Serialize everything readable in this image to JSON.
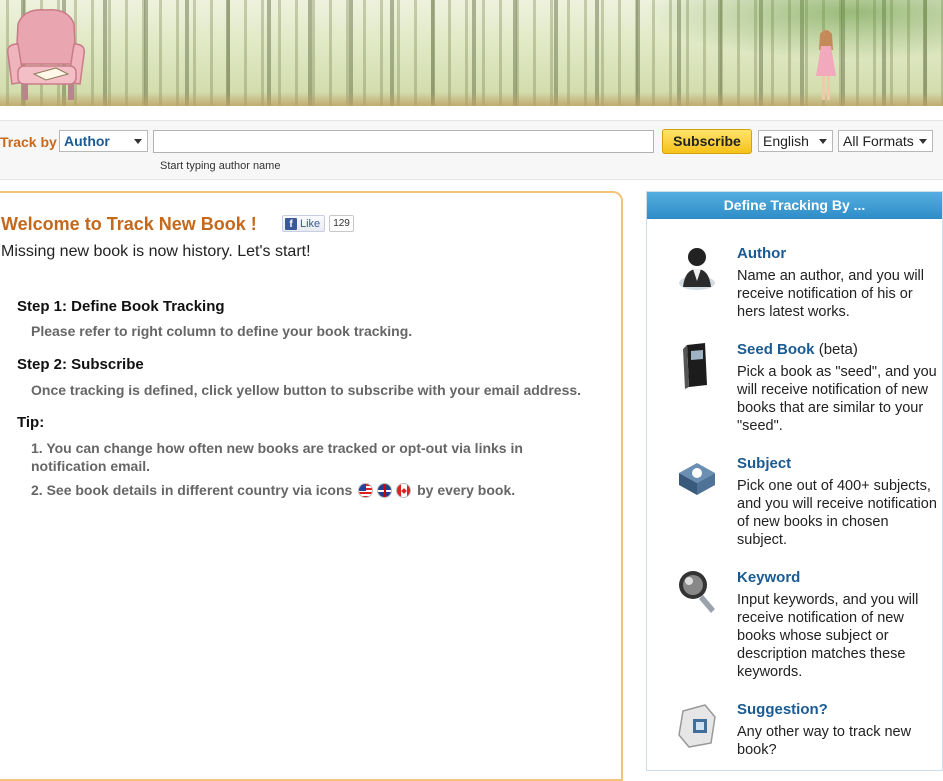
{
  "track_bar": {
    "label": "Track by",
    "track_type": "Author",
    "search_value": "",
    "search_hint": "Start typing author name",
    "subscribe_label": "Subscribe",
    "language": "English",
    "format": "All Formats"
  },
  "main": {
    "welcome_title": "Welcome to Track New Book !",
    "fb_like_label": "Like",
    "fb_like_count": "129",
    "tagline": "Missing new book is now history. Let's start!",
    "step1_title": "Step 1: Define Book Tracking",
    "step1_body": "Please refer to right column to define your book tracking.",
    "step2_title": "Step 2: Subscribe",
    "step2_body": "Once tracking is defined, click yellow button to subscribe with your email address.",
    "tip_title": "Tip:",
    "tip1": "1. You can change how often new books are tracked or opt-out via links in notification email.",
    "tip2_before": "2. See book details in different country via icons",
    "tip2_after": "by every book."
  },
  "sidebar": {
    "header": "Define Tracking By ...",
    "options": [
      {
        "title": "Author",
        "suffix": "",
        "desc": "Name an author, and you will receive notification of his or hers latest works.",
        "icon": "author-icon"
      },
      {
        "title": "Seed Book",
        "suffix": " (beta)",
        "desc": "Pick a book as \"seed\", and you will receive notification of new books that are similar to your \"seed\".",
        "icon": "seed-book-icon"
      },
      {
        "title": "Subject",
        "suffix": "",
        "desc": "Pick one out of 400+ subjects, and you will receive notification of new books in chosen subject.",
        "icon": "subject-icon"
      },
      {
        "title": "Keyword",
        "suffix": "",
        "desc": "Input keywords, and you will receive notification of new books whose subject or description matches these keywords.",
        "icon": "keyword-magnifier-icon"
      },
      {
        "title": "Suggestion?",
        "suffix": "",
        "desc": "Any other way to track new book?",
        "icon": "suggestion-icon"
      }
    ]
  },
  "colors": {
    "accent_orange": "#c4681c",
    "link_blue": "#1b5b93",
    "subscribe_yellow": "#f6c21a",
    "sidebar_header_blue": "#2e8cc7"
  }
}
